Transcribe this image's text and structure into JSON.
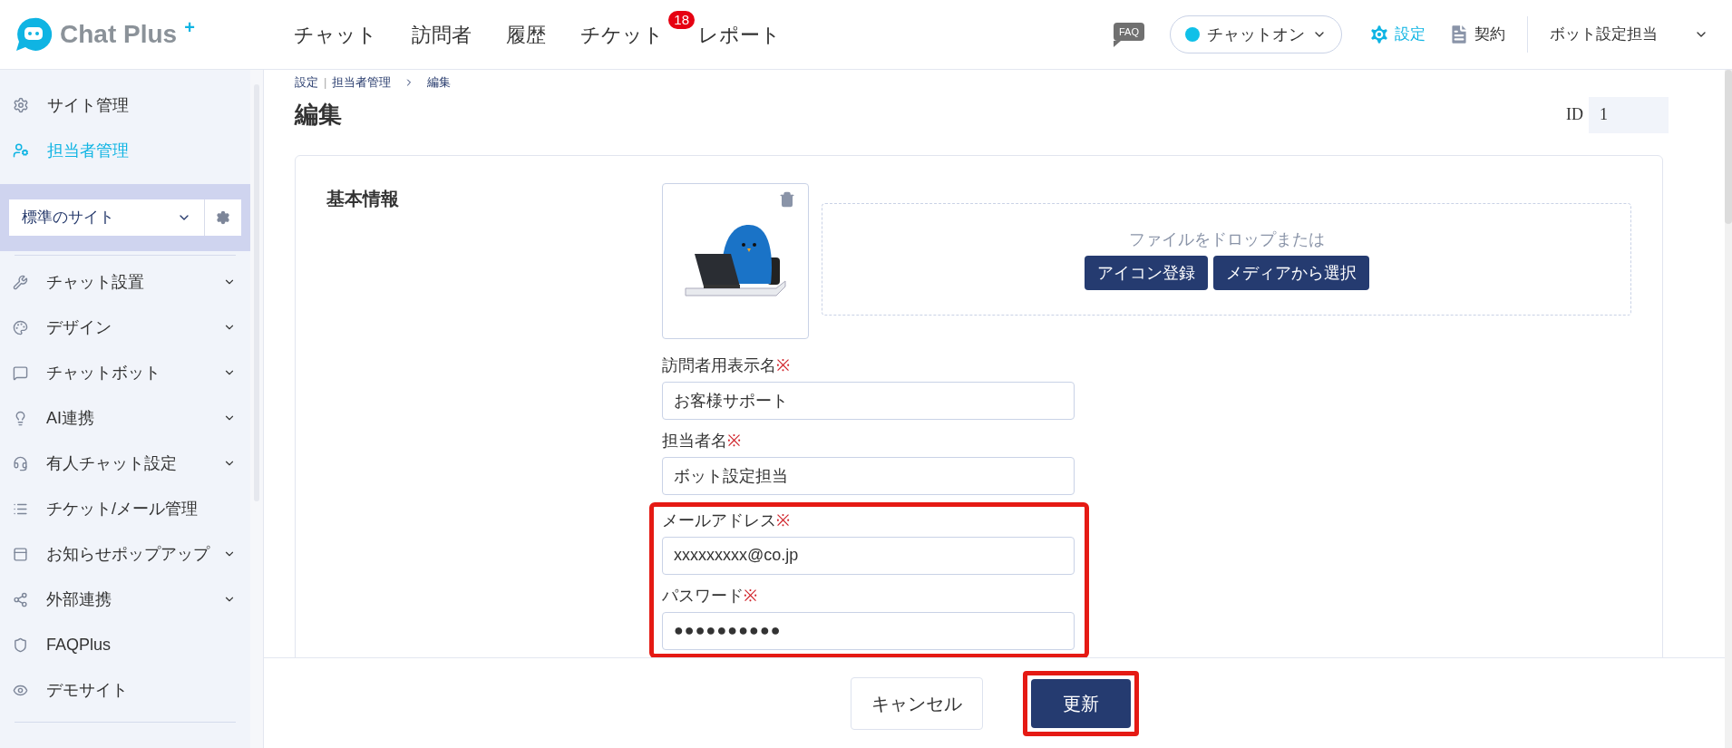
{
  "header": {
    "logo": {
      "name": "Chat Plus",
      "mark": "+"
    },
    "nav": [
      {
        "label": "チャット"
      },
      {
        "label": "訪問者"
      },
      {
        "label": "履歴"
      },
      {
        "label": "チケット",
        "badge": "18"
      },
      {
        "label": "レポート"
      }
    ],
    "faq": "FAQ",
    "status": {
      "label": "チャットオン",
      "color": "#10c0e8"
    },
    "settings": "設定",
    "contract": "契約",
    "user": "ボット設定担当"
  },
  "sidebar": {
    "top_items": [
      {
        "label": "サイト管理",
        "selected": false
      },
      {
        "label": "担当者管理",
        "selected": true
      }
    ],
    "site_select": {
      "value": "標準のサイト"
    },
    "items": [
      {
        "label": "チャット設置",
        "expandable": true
      },
      {
        "label": "デザイン",
        "expandable": true
      },
      {
        "label": "チャットボット",
        "expandable": true
      },
      {
        "label": "AI連携",
        "expandable": true
      },
      {
        "label": "有人チャット設定",
        "expandable": true
      },
      {
        "label": "チケット/メール管理",
        "expandable": false
      },
      {
        "label": "お知らせポップアップ",
        "expandable": true
      },
      {
        "label": "外部連携",
        "expandable": true
      },
      {
        "label": "FAQPlus",
        "expandable": false
      },
      {
        "label": "デモサイト",
        "expandable": false
      }
    ]
  },
  "breadcrumb": [
    "設定",
    "|",
    "担当者管理",
    "編集"
  ],
  "title": "編集",
  "id": {
    "label": "ID",
    "value": "1"
  },
  "section": {
    "title": "基本情報",
    "dropzone": {
      "text": "ファイルをドロップまたは",
      "buttons": [
        "アイコン登録",
        "メディアから選択"
      ]
    }
  },
  "fields": [
    {
      "label": "訪問者用表示名",
      "required_mark": "※",
      "value": "お客様サポート",
      "highlighted": false
    },
    {
      "label": "担当者名",
      "required_mark": "※",
      "value": "ボット設定担当",
      "highlighted": false
    },
    {
      "label": "メールアドレス",
      "required_mark": "※",
      "value": "xxxxxxxxx@co.jp",
      "highlighted": true
    },
    {
      "label": "パスワード",
      "required_mark": "※",
      "value": "●●●●●●●●●●",
      "highlighted": true
    }
  ],
  "footer": {
    "cancel": "キャンセル",
    "submit": {
      "label": "更新",
      "highlighted": true
    }
  }
}
